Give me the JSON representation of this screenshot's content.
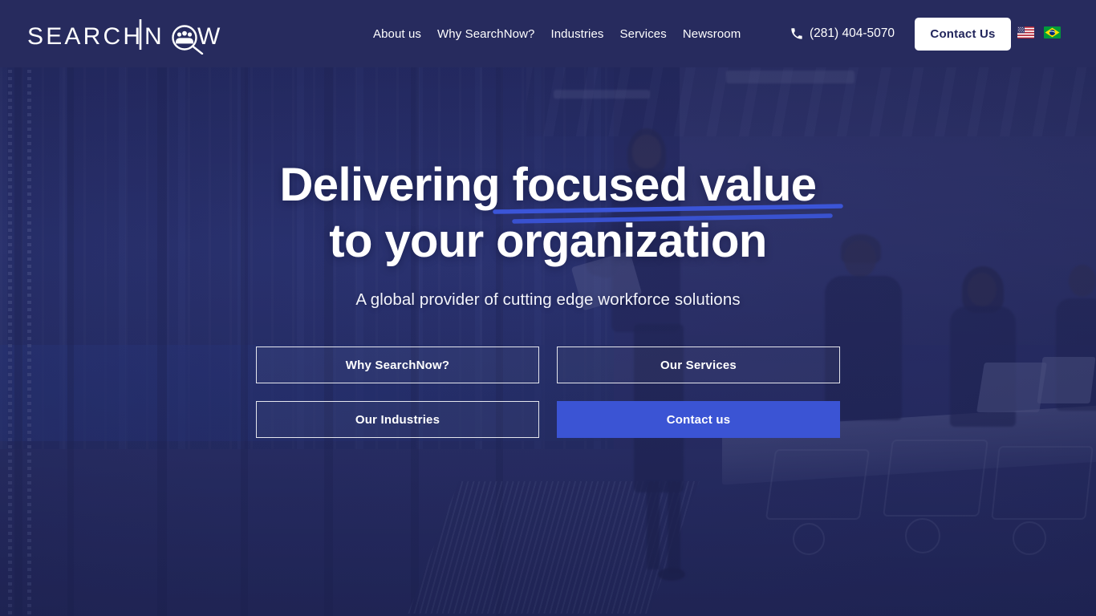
{
  "header": {
    "logo": {
      "text": "SEARCHNOW",
      "part_one": "SEARCH",
      "part_two": "N",
      "part_three": "W",
      "icon_name": "magnifier-people-logo",
      "alt": "SearchNow"
    },
    "nav": [
      {
        "label": "About us",
        "name": "nav-about-us"
      },
      {
        "label": "Why SearchNow?",
        "name": "nav-why-searchnow"
      },
      {
        "label": "Industries",
        "name": "nav-industries"
      },
      {
        "label": "Services",
        "name": "nav-services"
      },
      {
        "label": "Newsroom",
        "name": "nav-newsroom"
      }
    ],
    "phone": {
      "number": "(281) 404-5070",
      "icon": "phone-icon"
    },
    "contact_button": "Contact Us",
    "languages": [
      {
        "code": "en-US",
        "label": "United States",
        "icon": "flag-us-icon"
      },
      {
        "code": "pt-BR",
        "label": "Brazil",
        "icon": "flag-br-icon"
      }
    ]
  },
  "hero": {
    "headline_line1": "Delivering focused value",
    "headline_line2": "to your organization",
    "subtitle": "A global provider of cutting edge workforce solutions",
    "underline_decoration": "blue-double-brush-stroke",
    "buttons": [
      {
        "label": "Why SearchNow?",
        "style": "outline",
        "name": "cta-why-searchnow"
      },
      {
        "label": "Our Services",
        "style": "outline",
        "name": "cta-our-services"
      },
      {
        "label": "Our Industries",
        "style": "outline",
        "name": "cta-our-industries"
      },
      {
        "label": "Contact us",
        "style": "filled",
        "name": "cta-contact-us"
      }
    ]
  },
  "colors": {
    "header_navy": "#272b5e",
    "accent_blue": "#3b54d4",
    "underline_blue": "#3b55d8",
    "text_white": "#ffffff",
    "contact_btn_text": "#22265c"
  }
}
